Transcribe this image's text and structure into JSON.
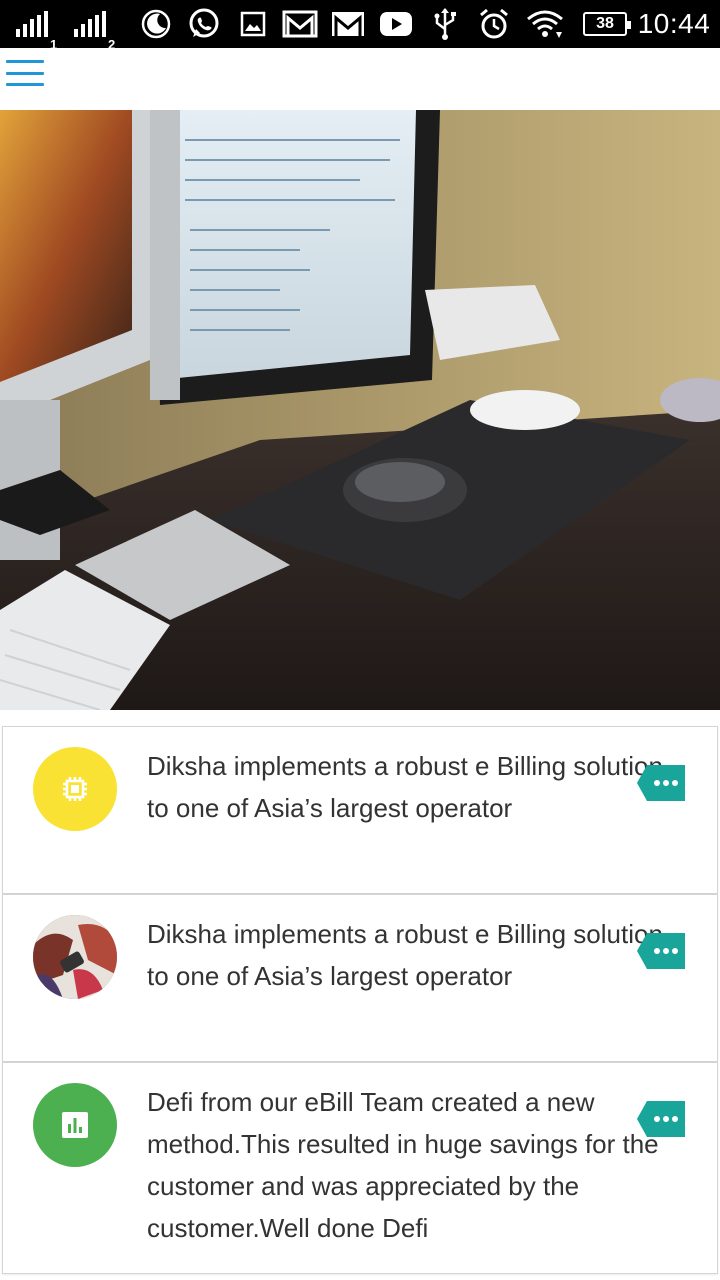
{
  "status_bar": {
    "sim1_label": "1",
    "sim2_label": "2",
    "battery": "38",
    "time": "10:44"
  },
  "app_bar": {
    "menu_icon": "hamburger-menu-icon"
  },
  "hero": {
    "description": "desk-workspace-photo"
  },
  "feed": [
    {
      "icon": "chip-icon",
      "avatar_color": "#f9e233",
      "text": "Diksha implements a robust e Billing solution to one of Asia’s largest operator"
    },
    {
      "icon": "photo-avatar",
      "text": "Diksha implements a robust e Billing solution to one of Asia’s largest operator"
    },
    {
      "icon": "bar-chart-icon",
      "avatar_color": "#4caf50",
      "text": "Defi from our eBill Team created a new method.This resulted in huge savings for the customer and was appreciated by the customer.Well done Defi"
    }
  ],
  "colors": {
    "accent": "#2196d9",
    "badge_teal": "#1aa59a",
    "status_bar": "#000000"
  }
}
